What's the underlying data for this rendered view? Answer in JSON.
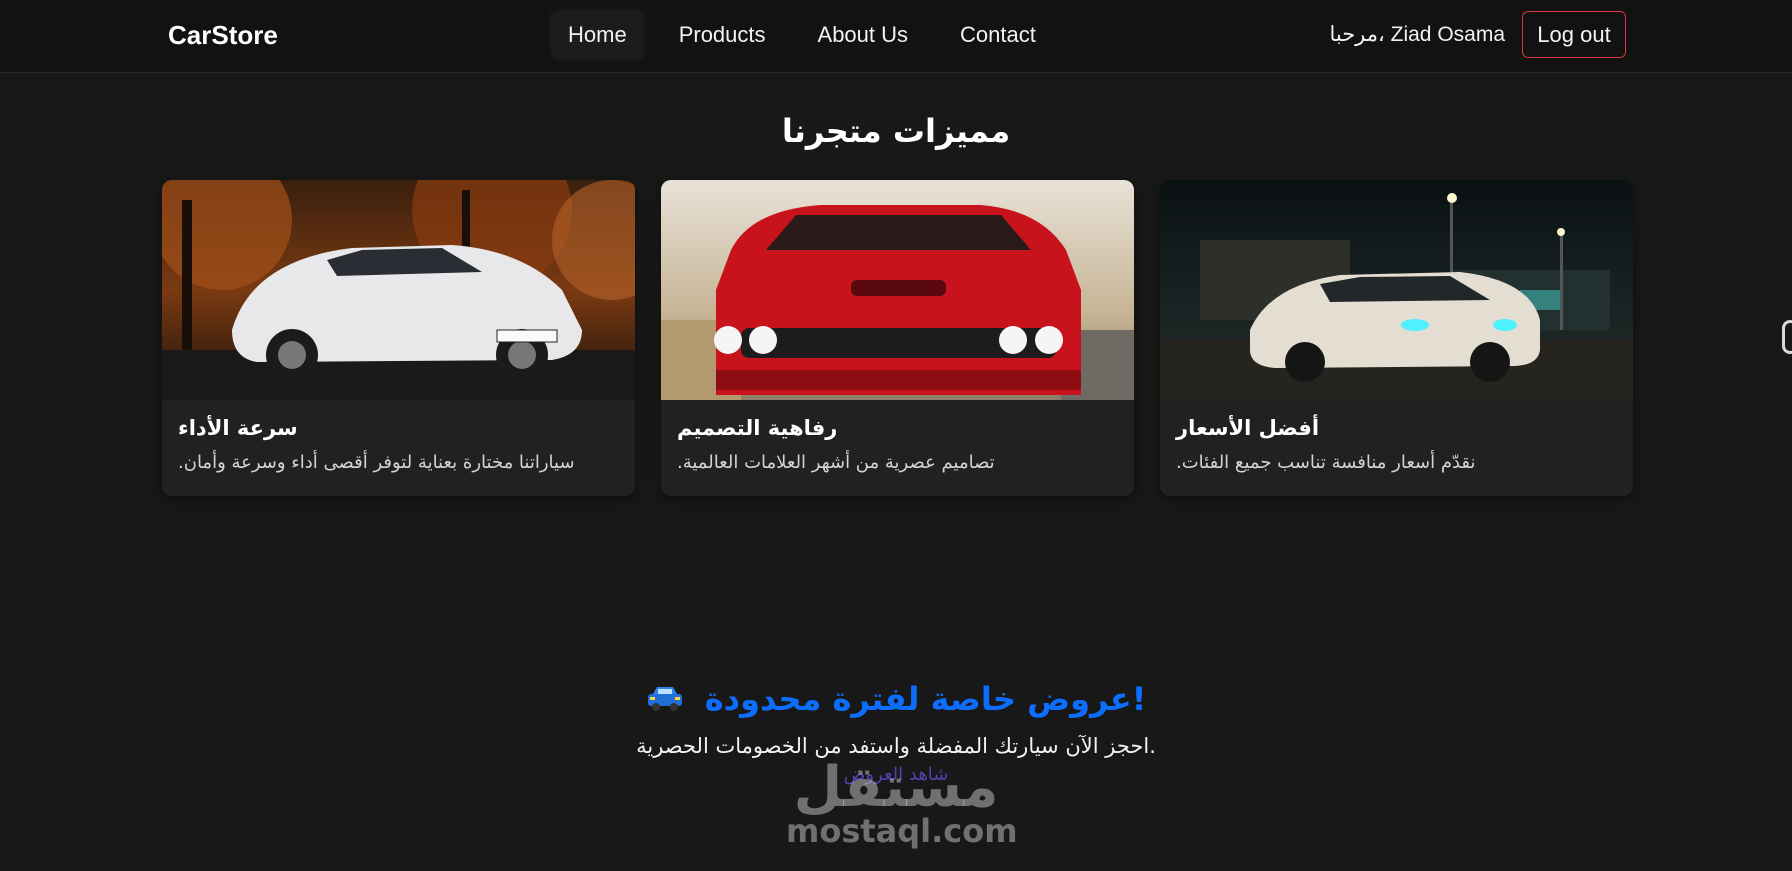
{
  "navbar": {
    "brand": "CarStore",
    "links": [
      {
        "label": "Home",
        "active": true
      },
      {
        "label": "Products",
        "active": false
      },
      {
        "label": "About Us",
        "active": false
      },
      {
        "label": "Contact",
        "active": false
      }
    ],
    "greeting": "مرحبا، Ziad Osama",
    "logout_label": "Log out"
  },
  "features": {
    "title": "مميزات متجرنا",
    "cards": [
      {
        "title": "سرعة الأداء",
        "text": "سياراتنا مختارة بعناية لتوفر أقصى أداء وسرعة وأمان.",
        "image": "white-coupe-autumn"
      },
      {
        "title": "رفاهية التصميم",
        "text": "تصاميم عصرية من أشهر العلامات العالمية.",
        "image": "red-muscle-car-front"
      },
      {
        "title": "أفضل الأسعار",
        "text": "نقدّم أسعار منافسة تناسب جميع الفئات.",
        "image": "white-sedan-night"
      }
    ]
  },
  "offer": {
    "title": "عروض خاصة لفترة محدودة!",
    "icon": "car-icon",
    "text": "احجز الآن سيارتك المفضلة واستفد من الخصومات الحصرية.",
    "link": "شاهد العروض"
  },
  "watermark": {
    "arabic": "مستقل",
    "latin": "mostaql.com"
  },
  "colors": {
    "background": "#181818",
    "navbar": "#121212",
    "card": "#212121",
    "accent": "#0d6efd",
    "logout_border": "#dc3545"
  }
}
